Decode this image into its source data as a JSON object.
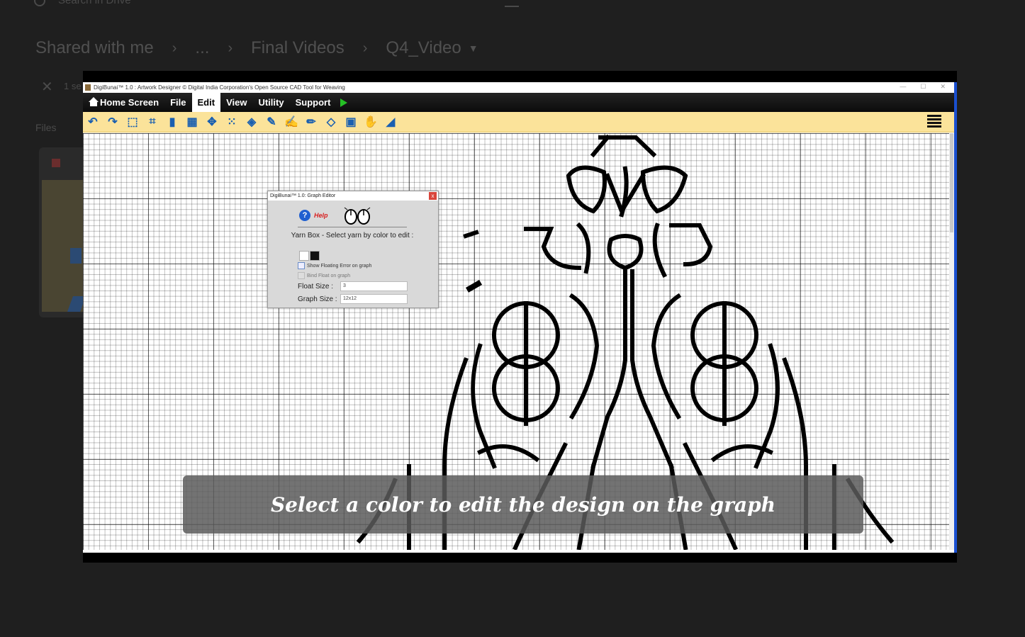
{
  "background": {
    "search_placeholder": "Search in Drive",
    "breadcrumb": [
      "Shared with me",
      "...",
      "Final Videos",
      "Q4_Video"
    ],
    "selection_text": "1 se",
    "files_label": "Files"
  },
  "app": {
    "title": "DigiBunai™ 1.0 : Artwork Designer © Digital India Corporation's Open Source CAD Tool for Weaving",
    "menu": {
      "home": "Home Screen",
      "file": "File",
      "edit": "Edit",
      "view": "View",
      "utility": "Utility",
      "support": "Support"
    },
    "toolbar_icons": [
      "undo-icon",
      "redo-icon",
      "select-icon",
      "crop-icon",
      "copy-icon",
      "pattern-icon",
      "move-icon",
      "grid-icon",
      "fill-icon",
      "brush-icon",
      "edit-icon",
      "pencil-icon",
      "eraser-icon",
      "paste-icon",
      "hand-icon",
      "paint-icon"
    ]
  },
  "dialog": {
    "title": "DigiBunai™ 1.0: Graph Editor",
    "close": "x",
    "help": "Help",
    "yarn_box": "Yarn Box - Select yarn by color to edit :",
    "show_floating": "Show Floating Error on graph",
    "bind_float": "Bind Float on graph",
    "float_size_label": "Float Size :",
    "float_size_value": "3",
    "graph_size_label": "Graph Size :",
    "graph_size_value": "12x12"
  },
  "caption": "Select a color to edit the design on the graph",
  "colors": {
    "toolbar_bg": "#fbe39a",
    "menubar_bg": "#111111",
    "accent_blue": "#1a4fd0",
    "play_green": "#25c025"
  }
}
